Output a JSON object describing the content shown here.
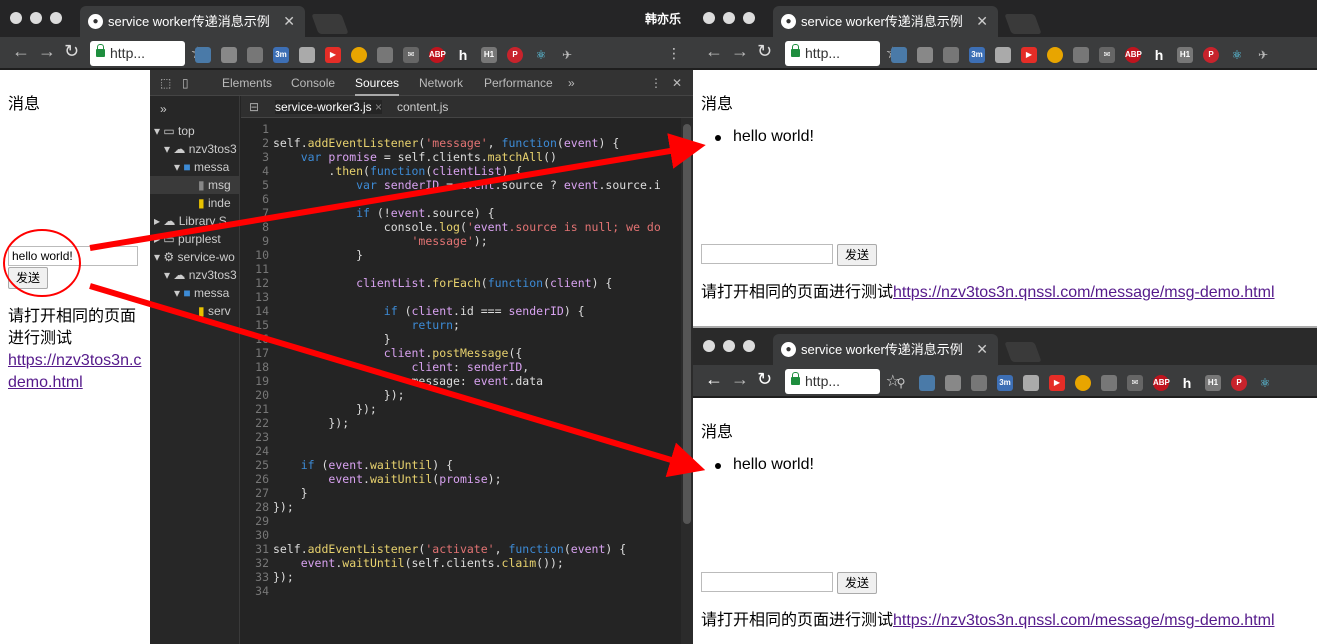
{
  "browser": {
    "tab_title": "service worker传递消息示例",
    "user_name": "韩亦乐",
    "url_display": "http...",
    "star": "☆",
    "menu": "⋮"
  },
  "page": {
    "heading": "消息",
    "messages": [
      "hello world!"
    ],
    "input_value": "hello world!",
    "send_label": "发送",
    "instruction": "请打开相同的页面进行测试",
    "link_text": "https://nzv3tos3n.qnssl.com/message/msg-demo.html",
    "narrow_instruction_1": "请打开相同的页面",
    "narrow_instruction_2": "进行测试",
    "narrow_link_1": "https://nzv3tos3n.c",
    "narrow_link_2": "demo.html"
  },
  "extensions": [
    "3m",
    "ABP",
    "h",
    "H1"
  ],
  "devtools": {
    "tabs": [
      "Elements",
      "Console",
      "Sources",
      "Network",
      "Performance"
    ],
    "more": "»",
    "selected_tab": "Sources",
    "file_tabs": [
      "service-worker3.js",
      "content.js"
    ],
    "tree": [
      "top",
      "nzv3tos3",
      "messa",
      "msg",
      "inde",
      "Library S",
      "purplest",
      "service-wo",
      "nzv3tos3",
      "messa",
      "serv"
    ],
    "code_lines": [
      "",
      "self.addEventListener('message', function(event) {",
      "    var promise = self.clients.matchAll()",
      "        .then(function(clientList) {",
      "            var senderID = event.source ? event.source.i",
      "",
      "            if (!event.source) {",
      "                console.log('event.source is null; we do",
      "                    'message');",
      "            }",
      "",
      "            clientList.forEach(function(client) {",
      "",
      "                if (client.id === senderID) {",
      "                    return;",
      "                }",
      "                client.postMessage({",
      "                    client: senderID,",
      "                    message: event.data",
      "                });",
      "            });",
      "        });",
      "",
      "",
      "    if (event.waitUntil) {",
      "        event.waitUntil(promise);",
      "    }",
      "});",
      "",
      "",
      "self.addEventListener('activate', function(event) {",
      "    event.waitUntil(self.clients.claim());",
      "});",
      ""
    ]
  }
}
